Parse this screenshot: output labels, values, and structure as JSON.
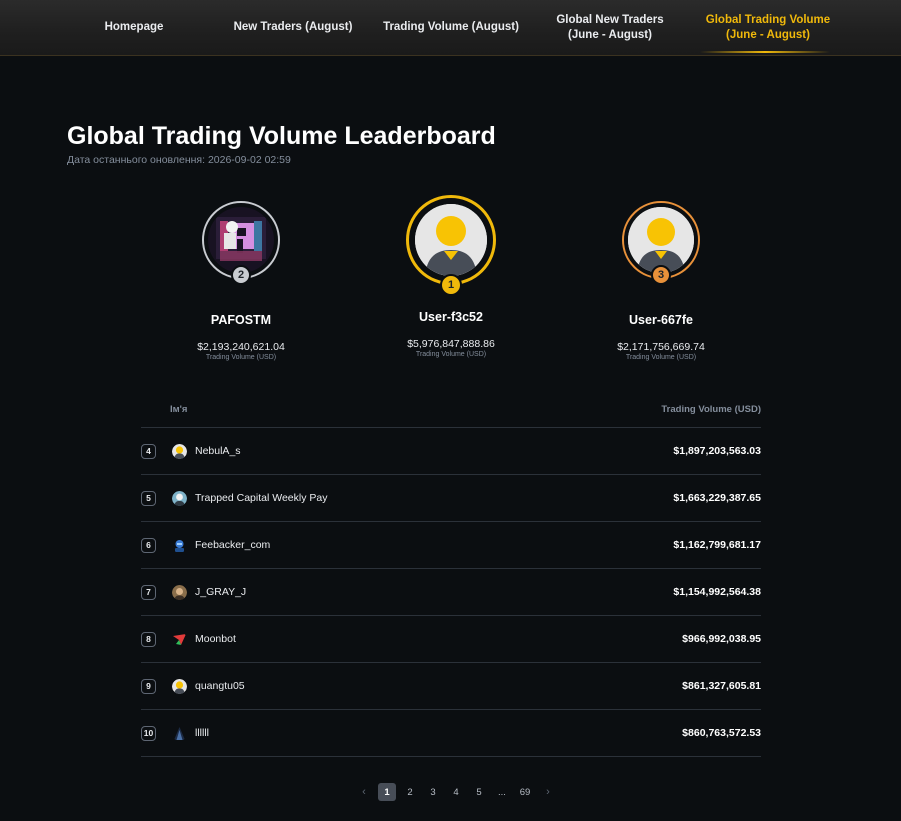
{
  "nav": {
    "items": [
      {
        "label": "Homepage"
      },
      {
        "label": "New Traders (August)"
      },
      {
        "label": "Trading Volume (August)"
      },
      {
        "label": "Global New Traders (June - August)"
      },
      {
        "label": "Global Trading Volume (June - August)"
      }
    ],
    "active_index": 4
  },
  "page": {
    "title": "Global Trading Volume Leaderboard",
    "updated": "Дата останнього оновлення: 2026-09-02 02:59"
  },
  "podium": [
    {
      "rank": "2",
      "name": "PAFOSTM",
      "volume": "$2,193,240,621.04",
      "volume_label": "Trading Volume (USD)",
      "ring_color": "#c9ccd1",
      "avatar": "custom-p-avatar"
    },
    {
      "rank": "1",
      "name": "User-f3c52",
      "volume": "$5,976,847,888.86",
      "volume_label": "Trading Volume (USD)",
      "ring_color": "#f0b90b",
      "avatar": "default-user-icon"
    },
    {
      "rank": "3",
      "name": "User-667fe",
      "volume": "$2,171,756,669.74",
      "volume_label": "Trading Volume (USD)",
      "ring_color": "#e8913a",
      "avatar": "default-user-icon"
    }
  ],
  "table": {
    "header_name": "Ім'я",
    "header_volume": "Trading Volume (USD)",
    "rows": [
      {
        "rank": "4",
        "name": "NebulA_s",
        "volume": "$1,897,203,563.03",
        "avatar": "default-user-icon"
      },
      {
        "rank": "5",
        "name": "Trapped Capital Weekly Pay",
        "volume": "$1,663,229,387.65",
        "avatar": "person-avatar"
      },
      {
        "rank": "6",
        "name": "Feebacker_com",
        "volume": "$1,162,799,681.17",
        "avatar": "robot-avatar"
      },
      {
        "rank": "7",
        "name": "J_GRAY_J",
        "volume": "$1,154,992,564.38",
        "avatar": "photo-avatar"
      },
      {
        "rank": "8",
        "name": "Moonbot",
        "volume": "$966,992,038.95",
        "avatar": "moonbot-logo"
      },
      {
        "rank": "9",
        "name": "quangtu05",
        "volume": "$861,327,605.81",
        "avatar": "default-user-icon"
      },
      {
        "rank": "10",
        "name": "llllll",
        "volume": "$860,763,572.53",
        "avatar": "dark-avatar"
      }
    ]
  },
  "pagination": {
    "prev": "‹",
    "pages": [
      "1",
      "2",
      "3",
      "4",
      "5",
      "...",
      "69"
    ],
    "current": "1",
    "next": "›"
  },
  "colors": {
    "accent": "#f0b90b",
    "background": "#0b0e11",
    "silver": "#c9ccd1",
    "bronze": "#e8913a"
  }
}
